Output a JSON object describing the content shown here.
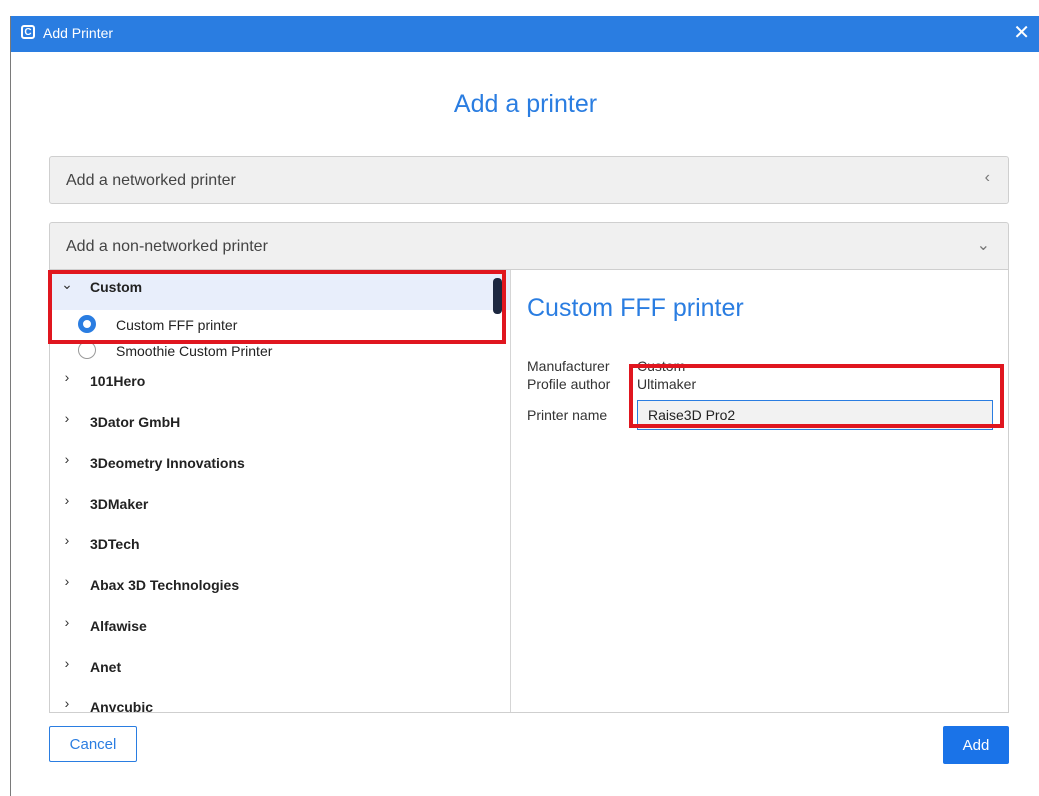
{
  "window": {
    "title": "Add Printer",
    "app_icon_glyph": "C"
  },
  "heading": "Add a printer",
  "sections": {
    "networked_label": "Add a networked printer",
    "non_networked_label": "Add a non-networked printer"
  },
  "tree": {
    "custom_group": {
      "label": "Custom",
      "expanded": true
    },
    "custom_items": [
      {
        "label": "Custom FFF printer",
        "selected": true
      },
      {
        "label": "Smoothie Custom Printer",
        "selected": false
      }
    ],
    "manufacturers": [
      "101Hero",
      "3Dator GmbH",
      "3Deometry Innovations",
      "3DMaker",
      "3DTech",
      "Abax 3D Technologies",
      "Alfawise",
      "Anet",
      "Anycubic"
    ]
  },
  "details": {
    "title": "Custom FFF printer",
    "manufacturer_label": "Manufacturer",
    "manufacturer_value": "Custom",
    "author_label": "Profile author",
    "author_value": "Ultimaker",
    "printer_name_label": "Printer name",
    "printer_name_value": "Raise3D Pro2"
  },
  "buttons": {
    "cancel": "Cancel",
    "add": "Add"
  },
  "colors": {
    "accent": "#2a7de1",
    "highlight": "#e0161f"
  }
}
